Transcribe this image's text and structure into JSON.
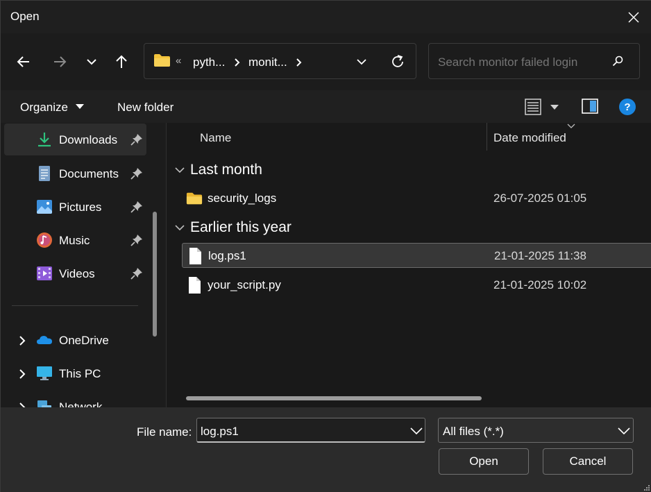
{
  "window": {
    "title": "Open"
  },
  "address": {
    "overflow_glyph": "«",
    "segments": [
      "pyth...",
      "monit..."
    ]
  },
  "search": {
    "placeholder": "Search monitor failed login"
  },
  "toolbar": {
    "organize_label": "Organize",
    "new_folder_label": "New folder"
  },
  "sidebar": {
    "quick_access": [
      {
        "label": "Downloads",
        "icon": "download-icon",
        "pinned": true,
        "active": true
      },
      {
        "label": "Documents",
        "icon": "document-icon",
        "pinned": true
      },
      {
        "label": "Pictures",
        "icon": "picture-icon",
        "pinned": true
      },
      {
        "label": "Music",
        "icon": "music-icon",
        "pinned": true
      },
      {
        "label": "Videos",
        "icon": "video-icon",
        "pinned": true
      }
    ],
    "locations": [
      {
        "label": "OneDrive",
        "icon": "onedrive-icon"
      },
      {
        "label": "This PC",
        "icon": "computer-icon"
      },
      {
        "label": "Network",
        "icon": "network-icon"
      }
    ]
  },
  "file_list": {
    "columns": {
      "name": "Name",
      "date_modified": "Date modified"
    },
    "groups": [
      {
        "label": "Last month",
        "items": [
          {
            "name": "security_logs",
            "type": "folder",
            "date": "26-07-2025 01:05"
          }
        ]
      },
      {
        "label": "Earlier this year",
        "items": [
          {
            "name": "log.ps1",
            "type": "file",
            "date": "21-01-2025 11:38",
            "selected": true
          },
          {
            "name": "your_script.py",
            "type": "file",
            "date": "21-01-2025 10:02"
          }
        ]
      }
    ]
  },
  "footer": {
    "file_name_label": "File name:",
    "file_name_value": "log.ps1",
    "file_type": "All files (*.*)",
    "open_label": "Open",
    "cancel_label": "Cancel"
  },
  "colors": {
    "accent": "#0078d4",
    "folder": "#f2c33b",
    "download": "#2ec27e"
  }
}
